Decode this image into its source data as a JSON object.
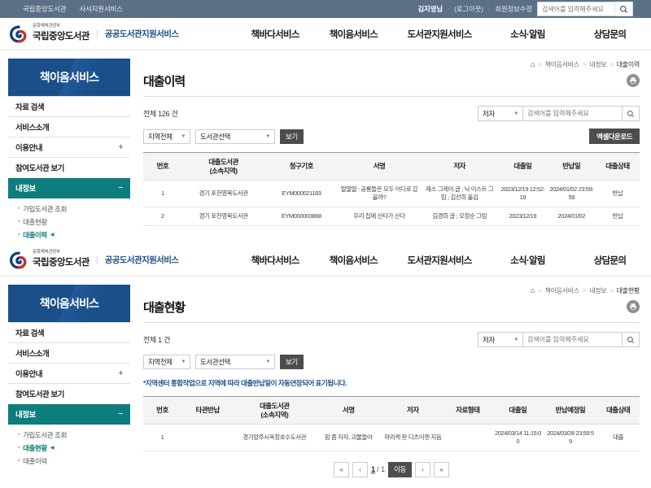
{
  "utilbar": {
    "links": [
      "국립중앙도서관",
      "사서지원서비스"
    ],
    "user": "김지영님",
    "logout": "(로그아웃)",
    "edit_profile": "회원정보수정",
    "search_placeholder": "검색어를 입력해주세요",
    "search_value": "",
    "bg_color": "#5b6f86"
  },
  "masthead": {
    "brand_sup": "문화체육관광부",
    "brand_main": "국립중앙도서관",
    "brand_sub": "공공도서관지원서비스",
    "gnb": [
      "책바다서비스",
      "책이음서비스",
      "도서관지원서비스",
      "소식·알림",
      "상담문의"
    ]
  },
  "sidebar": {
    "title": "책이음서비스",
    "items": [
      {
        "label": "자료 검색",
        "expander": ""
      },
      {
        "label": "서비스소개",
        "expander": ""
      },
      {
        "label": "이용안내",
        "expander": "+"
      },
      {
        "label": "참여도서관 보기",
        "expander": ""
      },
      {
        "label": "내정보",
        "expander": "−"
      }
    ],
    "sub_items": [
      "가입도서관 조회",
      "대출현황",
      "대출이력"
    ],
    "active_color": "#0e7d7d",
    "title_bg": "#1b4f8a"
  },
  "page_top": {
    "breadcrumb": [
      "책이음서비스",
      "내정보",
      "대출이력"
    ],
    "title": "대출이력",
    "print_icon": "printer-icon",
    "total_label": "전체 126 건",
    "search_type": "저자",
    "search_placeholder": "검색어를 입력해주세요",
    "search_value": "",
    "region_select": "지역전체",
    "library_select": "도서관선택",
    "view_button": "보기",
    "excel_button": "엑셀다운로드",
    "current_sub": "대출이력",
    "table": {
      "headers": [
        "번호",
        "대출도서관\n(소속지역)",
        "청구기호",
        "서명",
        "저자",
        "대출일",
        "반납일",
        "대출상태"
      ],
      "rows": [
        {
          "no": "1",
          "library": "경기 포천영북도서관",
          "callno": "EYM000021183",
          "title": "딸딸딸 : 공룡들은 모두 어디로 갔을까?",
          "author": "제스 그레이 글 ; 닉 이스트 그림 ; 김선희 옮김",
          "loan_date": "2023/12/19 12:52:19",
          "return_date": "2024/01/02 23:59:59",
          "status": "반납"
        },
        {
          "no": "2",
          "library": "경기 포천영북도서관",
          "callno": "EYM000003868",
          "title": "우리 집에 산타가 산다",
          "author": "김경희 글 ; 오정순 그림",
          "loan_date": "2023/12/19",
          "return_date": "2024/01/02",
          "status": "반납"
        }
      ]
    }
  },
  "page_bottom": {
    "breadcrumb": [
      "책이음서비스",
      "내정보",
      "대출현황"
    ],
    "title": "대출현황",
    "print_icon": "printer-icon",
    "total_label": "전체 1 건",
    "search_type": "저자",
    "search_placeholder": "검색어를 입력해주세요",
    "search_value": "",
    "region_select": "지역전체",
    "library_select": "도서관선택",
    "view_button": "보기",
    "notice": "*지역센터 통합작업으로 지역에 따라 대출반납일이 자동연장되어 표기됩니다.",
    "current_sub": "대출현황",
    "table": {
      "headers": [
        "번호",
        "타관반납",
        "대출도서관\n(소속지역)",
        "서명",
        "저자",
        "자료형태",
        "대출일",
        "반납예정일",
        "대출상태"
      ],
      "rows": [
        {
          "no": "1",
          "other_return": "",
          "library": "경기양주시옥정호수도서관",
          "title": "잠 좀 자자, 괴물들아",
          "author": "마리케 판 디츠이젠 지음",
          "material": "",
          "loan_date": "2024/03/14 11:15:00",
          "due_date": "2024/03/28 23:59:59",
          "status": "대출"
        }
      ]
    },
    "pagination": {
      "first": "«",
      "prev": "‹",
      "current": "1",
      "total": "/ 1",
      "go": "이동",
      "next": "›",
      "last": "»"
    }
  }
}
